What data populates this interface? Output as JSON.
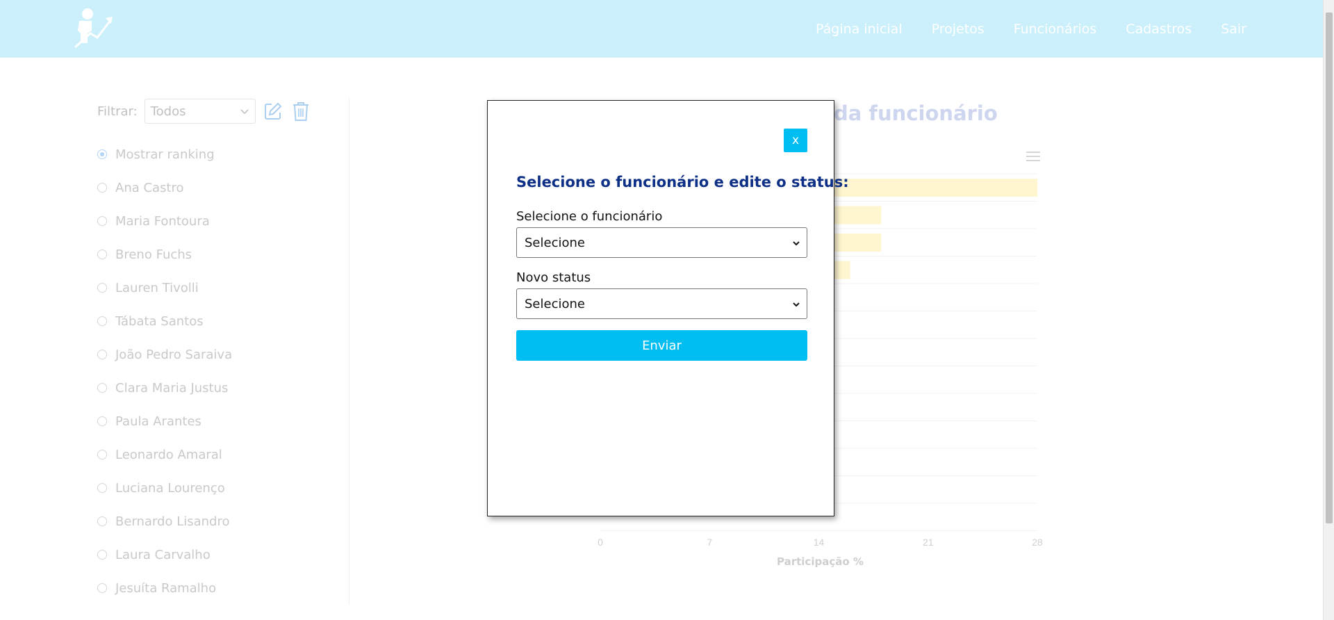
{
  "header": {
    "nav": [
      "Página inicial",
      "Projetos",
      "Funcionários",
      "Cadastros",
      "Sair"
    ]
  },
  "sidebar": {
    "filter_label": "Filtrar:",
    "filter_value": "Todos",
    "radio_items": [
      {
        "label": "Mostrar ranking",
        "checked": true
      },
      {
        "label": "Ana Castro",
        "checked": false
      },
      {
        "label": "Maria Fontoura",
        "checked": false
      },
      {
        "label": "Breno Fuchs",
        "checked": false
      },
      {
        "label": "Lauren Tivolli",
        "checked": false
      },
      {
        "label": "Tábata Santos",
        "checked": false
      },
      {
        "label": "João Pedro Saraiva",
        "checked": false
      },
      {
        "label": "Clara Maria Justus",
        "checked": false
      },
      {
        "label": "Paula Arantes",
        "checked": false
      },
      {
        "label": "Leonardo Amaral",
        "checked": false
      },
      {
        "label": "Luciana Lourenço",
        "checked": false
      },
      {
        "label": "Bernardo Lisandro",
        "checked": false
      },
      {
        "label": "Laura Carvalho",
        "checked": false
      },
      {
        "label": "Jesuíta Ramalho",
        "checked": false
      }
    ]
  },
  "chart": {
    "title_visible": "da funcionário",
    "xlabel": "Participação %",
    "xticks": [
      "0",
      "7",
      "14",
      "21",
      "28"
    ],
    "xlim": [
      0,
      28
    ],
    "bar_values": [
      28,
      18,
      18,
      16
    ],
    "bar_color": "#fff4c9"
  },
  "modal": {
    "close_label": "x",
    "title": "Selecione o funcionário e edite o status:",
    "employee_label": "Selecione o funcionário",
    "employee_value": "Selecione",
    "status_label": "Novo status",
    "status_value": "Selecione",
    "submit_label": "Enviar"
  },
  "colors": {
    "header_bg": "#c4eefb",
    "accent": "#00bdf2",
    "modal_title": "#0e2f86"
  }
}
